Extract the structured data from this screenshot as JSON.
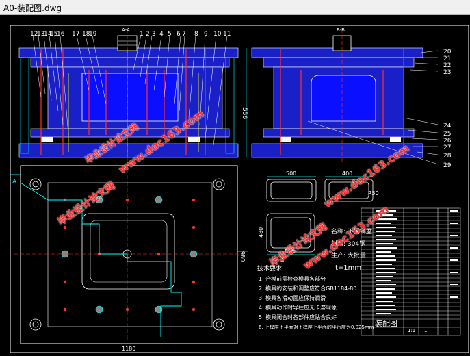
{
  "window": {
    "title": "A0-装配图.dwg"
  },
  "colors": {
    "canvas": "#000000",
    "body": "#1a20c8",
    "frame": "#ffffff",
    "cyan": "#00ffff",
    "yellow": "#ffff00",
    "red": "#ff2020"
  },
  "views": {
    "section_a_label": "A-A",
    "section_b_label": "B-B",
    "left_callouts": [
      "12",
      "13",
      "14",
      "15",
      "16",
      "17",
      "18",
      "19",
      "1",
      "2",
      "3",
      "4",
      "5",
      "6",
      "7",
      "8",
      "9",
      "10",
      "11"
    ],
    "right_callouts": [
      "20",
      "21",
      "22",
      "23",
      "24",
      "25",
      "26",
      "27",
      "28",
      "29"
    ],
    "dims": {
      "height": "556",
      "plan_height": "980",
      "plan_width": "1180",
      "cup_w1": "500",
      "cup_w2": "400",
      "cup_depth": "R50",
      "cup_h": "480",
      "cup_w3": "500"
    },
    "marker_a": "A",
    "marker_b": "A"
  },
  "notes": {
    "heading": "技术要求",
    "items": [
      "1. 合模前需检查模具各部分",
      "2. 模具的安装和调整应符合GB1184-80",
      "3. 模具各滑动面应保持润滑",
      "4. 模具动作时导柱应无卡滞现象",
      "5. 模具闭合时各部件应贴合良好",
      "6. 上模座下平面对下模座上平面的平行度为0.025mm"
    ],
    "material_heading": "名称: 不锈钢盆",
    "material": "材料: 304钢",
    "quantity": "生产: 大批量",
    "thickness": "t=1mm"
  },
  "title_block": {
    "title": "装配图",
    "scale": "1:1",
    "sheet": "1"
  },
  "watermarks": [
    "毕业设计论文网",
    "www.doc163.com"
  ]
}
